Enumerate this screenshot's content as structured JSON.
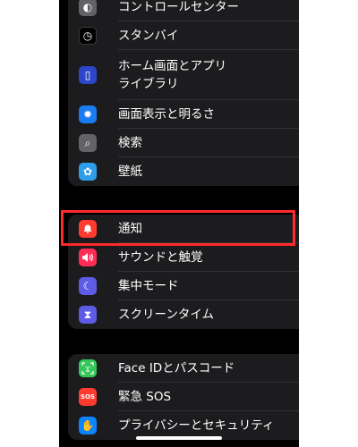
{
  "group1": [
    {
      "label": "コントロールセンター",
      "icon": "toggle-icon",
      "icon_color": "#636366",
      "glyph": "◐"
    },
    {
      "label": "スタンバイ",
      "icon": "clock-icon",
      "icon_color": "#1c1c1e",
      "glyph": "◷"
    },
    {
      "label": "ホーム画面とアプリ",
      "label2": "ライブラリ",
      "icon": "phone-icon",
      "icon_color": "#2d46c9",
      "glyph": "▯"
    },
    {
      "label": "画面表示と明るさ",
      "icon": "sun-icon",
      "icon_color": "#1a7bf2",
      "glyph": "✹"
    },
    {
      "label": "検索",
      "icon": "search-icon",
      "icon_color": "#636366",
      "glyph": "⌕"
    },
    {
      "label": "壁紙",
      "icon": "flower-icon",
      "icon_color": "#2f9ee8",
      "glyph": "✿"
    }
  ],
  "group2": [
    {
      "label": "通知",
      "icon": "bell-icon",
      "icon_color": "#ff3b30",
      "glyph": "♣"
    },
    {
      "label": "サウンドと触覚",
      "icon": "speaker-icon",
      "icon_color": "#ff2d55",
      "glyph": "◀"
    },
    {
      "label": "集中モード",
      "icon": "moon-icon",
      "icon_color": "#5e5ce6",
      "glyph": "☾"
    },
    {
      "label": "スクリーンタイム",
      "icon": "hourglass-icon",
      "icon_color": "#5e5ce6",
      "glyph": "⧗"
    }
  ],
  "group3": [
    {
      "label": "Face IDとパスコード",
      "icon": "face-id-icon",
      "icon_color": "#34c759",
      "glyph": "☺"
    },
    {
      "label": "緊急 SOS",
      "icon": "sos-icon",
      "icon_color": "#ff3b30",
      "glyph": "SOS"
    },
    {
      "label": "プライバシーとセキュリティ",
      "icon": "hand-icon",
      "icon_color": "#0a84ff",
      "glyph": "✋"
    }
  ],
  "chevron": "›",
  "highlighted_item": "通知",
  "highlight_color": "#ff2a2a"
}
